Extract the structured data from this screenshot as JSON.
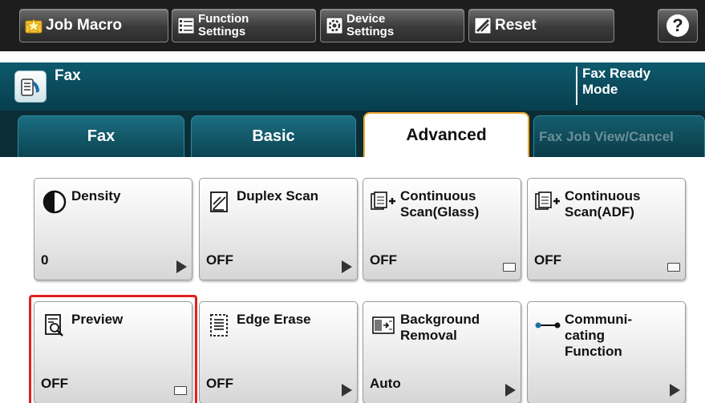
{
  "toolbar": {
    "job_macro": "Job Macro",
    "function_line1": "Function",
    "function_line2": "Settings",
    "device_line1": "Device",
    "device_line2": "Settings",
    "reset": "Reset",
    "help": "?"
  },
  "status": {
    "mode_title": "Fax",
    "ready_line1": "Fax Ready",
    "ready_line2": "Mode"
  },
  "tabs": {
    "fax": "Fax",
    "basic": "Basic",
    "advanced": "Advanced",
    "fax_job": "Fax Job View/Cancel",
    "selected": "Advanced"
  },
  "settings": [
    {
      "title": "Density",
      "value": "0",
      "indicator": "arrow",
      "icon": "density-icon"
    },
    {
      "title": "Duplex Scan",
      "value": "OFF",
      "indicator": "arrow",
      "icon": "duplex-scan-icon"
    },
    {
      "title": "Continuous Scan(Glass)",
      "value": "OFF",
      "indicator": "checkbox",
      "icon": "continuous-scan-icon"
    },
    {
      "title": "Continuous Scan(ADF)",
      "value": "OFF",
      "indicator": "checkbox",
      "icon": "continuous-scan-icon"
    },
    {
      "title": "Preview",
      "value": "OFF",
      "indicator": "checkbox",
      "icon": "preview-icon"
    },
    {
      "title": "Edge Erase",
      "value": "OFF",
      "indicator": "arrow",
      "icon": "edge-erase-icon"
    },
    {
      "title": "Background Removal",
      "value": "Auto",
      "indicator": "arrow",
      "icon": "background-removal-icon"
    },
    {
      "title": "Communi- cating Function",
      "value": "",
      "indicator": "arrow",
      "icon": "communicating-function-icon"
    }
  ],
  "colors": {
    "toolbar_bg": "#1d1d1d",
    "status_bg": "#0e5a6e",
    "tab_active_border": "#f2a62f",
    "highlight": "#e02020"
  }
}
